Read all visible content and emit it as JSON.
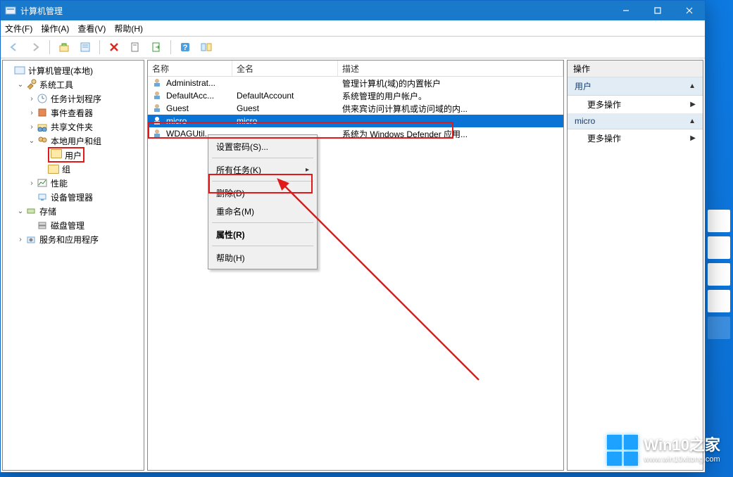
{
  "window": {
    "title": "计算机管理"
  },
  "menu": {
    "file": "文件(F)",
    "action": "操作(A)",
    "view": "查看(V)",
    "help": "帮助(H)"
  },
  "tree": {
    "root": "计算机管理(本地)",
    "tools": "系统工具",
    "scheduler": "任务计划程序",
    "eventviewer": "事件查看器",
    "sharedfolders": "共享文件夹",
    "localusers": "本地用户和组",
    "users": "用户",
    "groups": "组",
    "performance": "性能",
    "devicemgr": "设备管理器",
    "storage": "存储",
    "diskmgmt": "磁盘管理",
    "services": "服务和应用程序"
  },
  "list": {
    "headers": {
      "name": "名称",
      "fullname": "全名",
      "desc": "描述"
    },
    "rows": [
      {
        "name": "Administrat...",
        "fullname": "",
        "desc": "管理计算机(域)的内置帐户"
      },
      {
        "name": "DefaultAcc...",
        "fullname": "DefaultAccount",
        "desc": "系统管理的用户帐户。"
      },
      {
        "name": "Guest",
        "fullname": "Guest",
        "desc": "供来宾访问计算机或访问域的内..."
      },
      {
        "name": "micro",
        "fullname": "micro",
        "desc": ""
      },
      {
        "name": "WDAGUtil...",
        "fullname": "",
        "desc": "系统为 Windows Defender 应用..."
      }
    ]
  },
  "ctx": {
    "setpwd": "设置密码(S)...",
    "alltasks": "所有任务(K)",
    "delete": "删除(D)",
    "rename": "重命名(M)",
    "properties": "属性(R)",
    "help": "帮助(H)"
  },
  "actions": {
    "title": "操作",
    "users": "用户",
    "more": "更多操作",
    "micro": "micro"
  },
  "watermark": {
    "brand": "Win10之家",
    "url": "www.win10xitong.com"
  }
}
